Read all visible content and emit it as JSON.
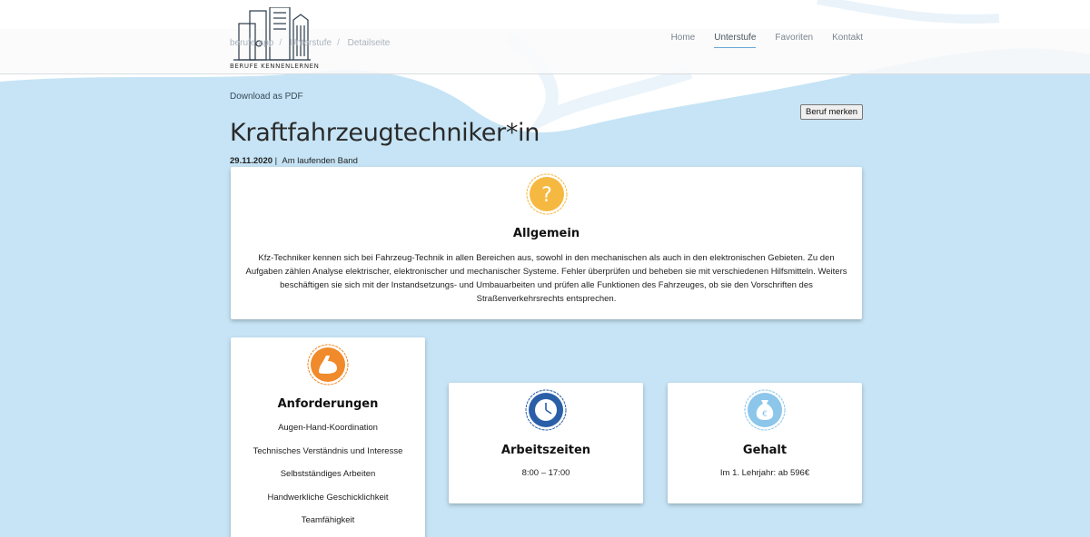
{
  "header": {
    "logo_text": "BERUFE KENNENLERNEN",
    "breadcrumb": [
      "berufe-app",
      "Unterstufe",
      "Detailseite"
    ],
    "nav": [
      {
        "label": "Home",
        "active": false
      },
      {
        "label": "Unterstufe",
        "active": true
      },
      {
        "label": "Favoriten",
        "active": false
      },
      {
        "label": "Kontakt",
        "active": false
      }
    ]
  },
  "actions": {
    "pdf_label": "Download as PDF",
    "merken_label": "Beruf merken"
  },
  "page": {
    "title": "Kraftfahrzeugtechniker*in",
    "date": "29.11.2020",
    "separator": "|",
    "category": "Am laufenden Band"
  },
  "allgemein": {
    "icon": "question-mark-icon",
    "title": "Allgemein",
    "text": "Kfz-Techniker kennen sich bei Fahrzeug-Technik in allen Bereichen aus, sowohl in den mechanischen als auch in den elektronischen Gebieten. Zu den Aufgaben zählen Analyse elektrischer, elektronischer und mechanischer Systeme. Fehler überprüfen und beheben sie mit verschiedenen Hilfsmitteln. Weiters beschäftigen sie sich mit der Instandsetzungs- und Umbauarbeiten und prüfen alle Funktionen des Fahrzeuges, ob sie den Vorschriften des Straßenverkehrsrechts entsprechen."
  },
  "anforderungen": {
    "icon": "muscle-arm-icon",
    "title": "Anforderungen",
    "items": [
      "Augen-Hand-Koordination",
      "Technisches Verständnis und Interesse",
      "Selbstständiges Arbeiten",
      "Handwerkliche Geschicklichkeit",
      "Teamfähigkeit"
    ]
  },
  "arbeitszeiten": {
    "icon": "clock-icon",
    "title": "Arbeitszeiten",
    "text": "8:00 – 17:00"
  },
  "gehalt": {
    "icon": "money-bag-icon",
    "title": "Gehalt",
    "text": "Im 1. Lehrjahr: ab 596€"
  },
  "colors": {
    "background": "#c6e4f5",
    "allgemein_icon": "#f5b942",
    "anforderungen_icon": "#f08a2a",
    "arbeitszeiten_icon": "#2a5fa8",
    "gehalt_icon": "#8cc6ea",
    "nav_active_underline": "#6aa6d6"
  }
}
